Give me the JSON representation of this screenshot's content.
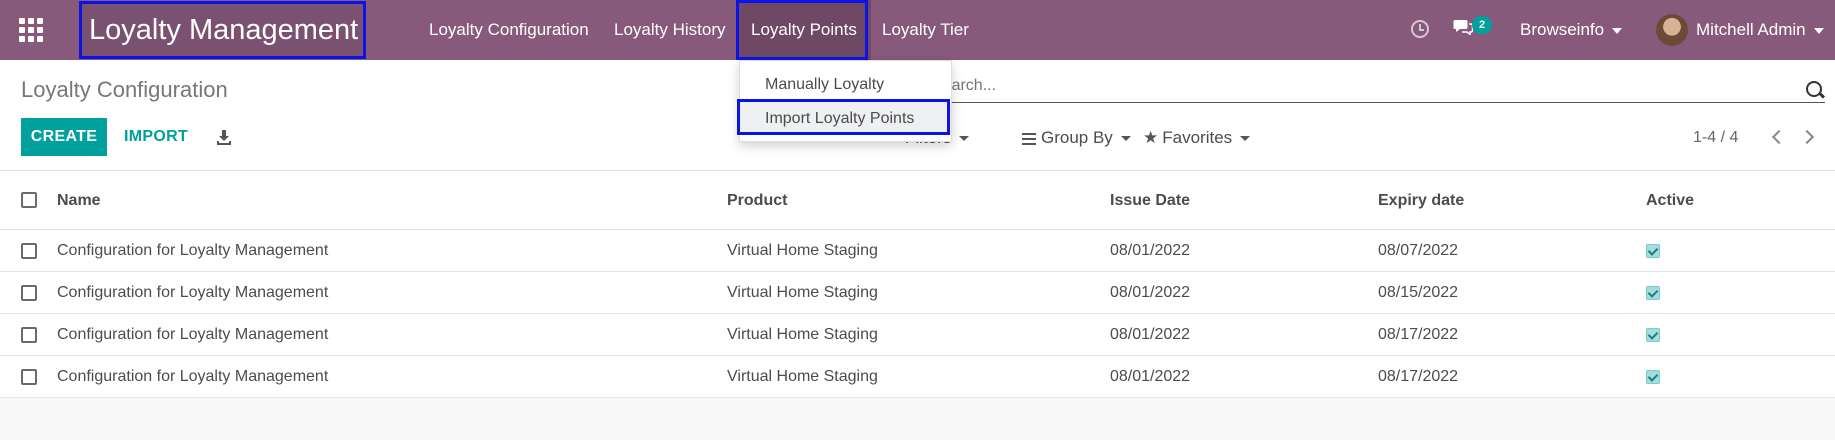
{
  "navbar": {
    "brand": "Loyalty Management",
    "menu": [
      {
        "label": "Loyalty Configuration"
      },
      {
        "label": "Loyalty History"
      },
      {
        "label": "Loyalty Points"
      },
      {
        "label": "Loyalty Tier"
      }
    ],
    "activity_icon": "clock-icon",
    "messages_icon": "chat-icon",
    "messages_count": "2",
    "company": "Browseinfo",
    "user": "Mitchell Admin",
    "colors": {
      "navbar": "#875a7b",
      "accent": "#00a09d",
      "highlight": "#0b14e6"
    }
  },
  "dropdown": {
    "items": [
      {
        "label": "Manually Loyalty"
      },
      {
        "label": "Import Loyalty Points"
      }
    ]
  },
  "control_panel": {
    "title": "Loyalty Configuration",
    "create_label": "CREATE",
    "import_label": "IMPORT",
    "download_icon": "download-icon",
    "search_placeholder": "Search...",
    "filters_label": "Filters",
    "group_by_label": "Group By",
    "favorites_label": "Favorites",
    "pager": "1-4 / 4"
  },
  "table": {
    "columns": [
      "Name",
      "Product",
      "Issue Date",
      "Expiry date",
      "Active"
    ],
    "rows": [
      {
        "name": "Configuration for Loyalty Management",
        "product": "Virtual Home Staging",
        "issue_date": "08/01/2022",
        "expiry_date": "08/07/2022",
        "active": true
      },
      {
        "name": "Configuration for Loyalty Management",
        "product": "Virtual Home Staging",
        "issue_date": "08/01/2022",
        "expiry_date": "08/15/2022",
        "active": true
      },
      {
        "name": "Configuration for Loyalty Management",
        "product": "Virtual Home Staging",
        "issue_date": "08/01/2022",
        "expiry_date": "08/17/2022",
        "active": true
      },
      {
        "name": "Configuration for Loyalty Management",
        "product": "Virtual Home Staging",
        "issue_date": "08/01/2022",
        "expiry_date": "08/17/2022",
        "active": true
      }
    ]
  }
}
